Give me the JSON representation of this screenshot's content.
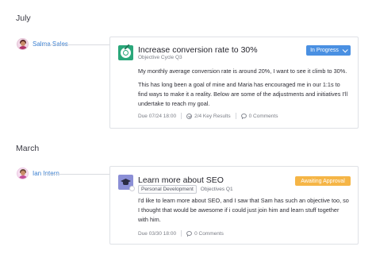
{
  "groups": [
    {
      "month": "July",
      "user": {
        "name": "Salma Sales",
        "avatar": "avatar-salma"
      },
      "objective": {
        "icon": "target-icon",
        "title": "Increase conversion rate to 30%",
        "subtitle": "Objective Cycle Q3",
        "status": {
          "label": "In Progress",
          "color": "#4a90e2"
        },
        "body": [
          "My monthly average conversion rate is around 20%, I want to see it climb to 30%.",
          "This has long been a goal of mine and Maria has encouraged me in our 1:1s to find ways to make it a reality. Below are some of the adjustments and initiatives I'll undertake to reach my goal."
        ],
        "due": "Due 07/24 18:00",
        "key_results": "2/4 Key Results",
        "comments": "0 Comments"
      }
    },
    {
      "month": "March",
      "user": {
        "name": "Ian Intern",
        "avatar": "avatar-ian"
      },
      "objective": {
        "icon": "graduation-cap-icon",
        "title": "Learn more about SEO",
        "tag": "Personal Development",
        "cycle": "Objectives Q1",
        "status": {
          "label": "Awaiting Approval",
          "color": "#f5b546"
        },
        "body": [
          "I'd like to learn more about SEO, and I saw that Sam has such an objective too, so I thought that would be awesome if i could just join him and learn stuff together with him."
        ],
        "due": "Due 03/30 18:00",
        "comments": "0 Comments"
      }
    }
  ]
}
